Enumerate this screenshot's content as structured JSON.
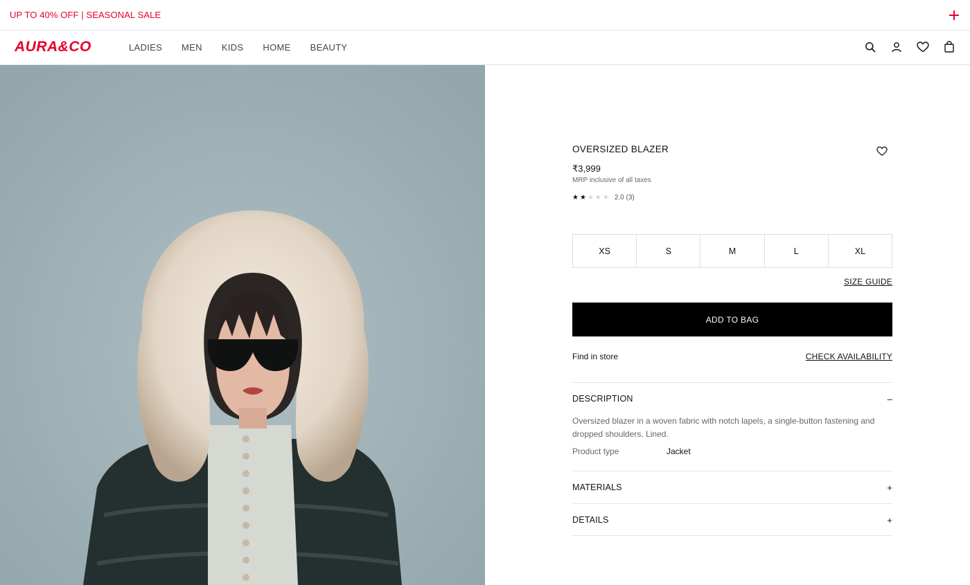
{
  "promo": {
    "text": "UP TO 40% OFF | SEASONAL SALE"
  },
  "header": {
    "logo": "AURA&CO",
    "nav": [
      "LADIES",
      "MEN",
      "KIDS",
      "HOME",
      "BEAUTY"
    ],
    "icons": [
      "search-icon",
      "account-icon",
      "wishlist-icon",
      "bag-icon"
    ]
  },
  "colors": {
    "brand": "#e4002b",
    "button": "#000000",
    "hero_bg": "#9fb3b8"
  },
  "product": {
    "title": "OVERSIZED BLAZER",
    "price": "₹3,999",
    "tax_note": "MRP inclusive of all taxes",
    "rating": {
      "stars_filled": 2,
      "stars_total": 5,
      "text": "2.0 (3)"
    },
    "sizes": [
      "XS",
      "S",
      "M",
      "L",
      "XL"
    ],
    "size_guide": "SIZE GUIDE",
    "add_to_bag": "ADD TO BAG",
    "find_in_store": "Find in store",
    "check_availability": "CHECK AVAILABILITY",
    "accordions": {
      "description": {
        "title": "DESCRIPTION",
        "sign": "–",
        "body": "Oversized blazer in a woven fabric with notch lapels, a single-button fastening and dropped shoulders. Lined.",
        "meta_key": "Product type",
        "meta_val": "Jacket"
      },
      "materials": {
        "title": "MATERIALS",
        "sign": "+"
      },
      "details": {
        "title": "DETAILS",
        "sign": "+"
      }
    }
  }
}
